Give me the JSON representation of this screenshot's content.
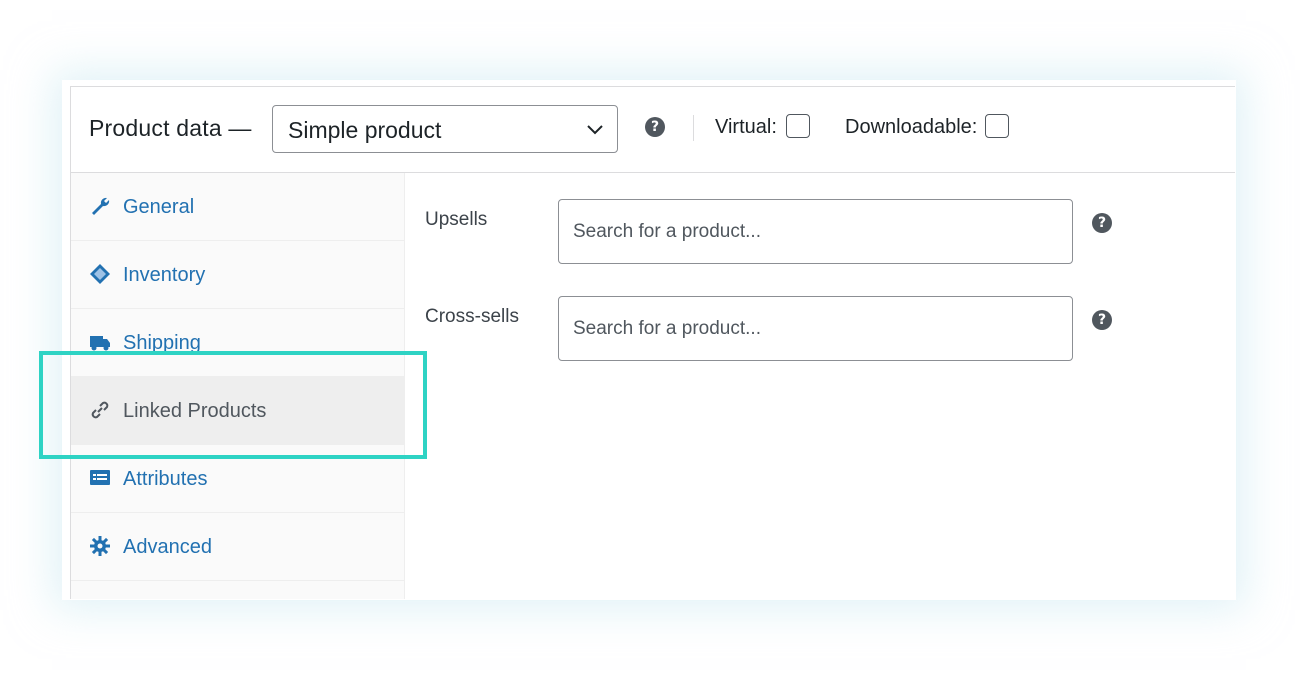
{
  "header": {
    "title": "Product data —",
    "product_type": "Simple product",
    "virtual_label": "Virtual:",
    "downloadable_label": "Downloadable:",
    "virtual_checked": false,
    "downloadable_checked": false
  },
  "sidebar": {
    "items": [
      {
        "label": "General",
        "icon": "wrench-icon"
      },
      {
        "label": "Inventory",
        "icon": "tag-icon"
      },
      {
        "label": "Shipping",
        "icon": "truck-icon"
      },
      {
        "label": "Linked Products",
        "icon": "link-icon",
        "active": true
      },
      {
        "label": "Attributes",
        "icon": "list-icon"
      },
      {
        "label": "Advanced",
        "icon": "gear-icon"
      }
    ]
  },
  "linked": {
    "upsells_label": "Upsells",
    "upsells_placeholder": "Search for a product...",
    "crosssells_label": "Cross-sells",
    "crosssells_placeholder": "Search for a product..."
  },
  "colors": {
    "link": "#2271b1",
    "highlight": "#2ed3c4",
    "help_icon": "#50575e",
    "active_tab_bg": "#eeeeee"
  },
  "icons": {
    "help": "help-icon",
    "select_arrow": "chevron-down-icon"
  }
}
